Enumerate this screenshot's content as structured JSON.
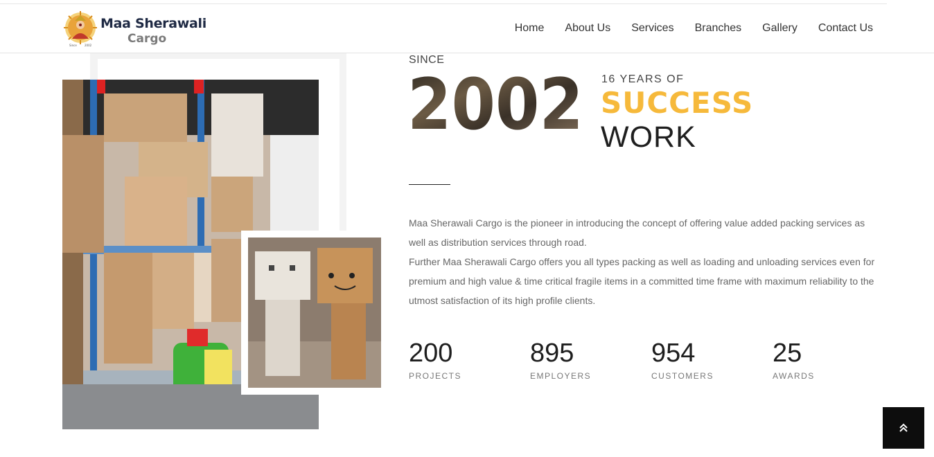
{
  "brand": {
    "name_line1": "Maa Sherawali",
    "name_line2": "Cargo",
    "emblem_year_left": "Since",
    "emblem_year_right": "2002"
  },
  "nav": [
    {
      "label": "Home"
    },
    {
      "label": "About Us"
    },
    {
      "label": "Services"
    },
    {
      "label": "Branches"
    },
    {
      "label": "Gallery"
    },
    {
      "label": "Contact Us"
    }
  ],
  "hero": {
    "since": "SINCE",
    "year": "2002",
    "years_of": "16 YEARS OF",
    "success": "SUCCESS",
    "work": "WORK"
  },
  "about": {
    "paragraph1": "Maa Sherawali Cargo is the pioneer in introducing the concept of offering value added packing services as well as distribution services through road.",
    "paragraph2": "Further Maa Sherawali Cargo offers you all types packing as well as loading and unloading services even for premium and high value & time critical fragile items in a committed time frame with maximum reliability to the utmost satisfaction of its high profile clients."
  },
  "stats": [
    {
      "value": "200",
      "label": "PROJECTS"
    },
    {
      "value": "895",
      "label": "EMPLOYERS"
    },
    {
      "value": "954",
      "label": "CUSTOMERS"
    },
    {
      "value": "25",
      "label": "AWARDS"
    }
  ],
  "colors": {
    "accent": "#f6b93b",
    "dark": "#1f1f1f",
    "text_muted": "#666666",
    "scroll_button": "#0d0d0d"
  },
  "icons": {
    "scroll_top": "double-chevron-up-icon"
  }
}
